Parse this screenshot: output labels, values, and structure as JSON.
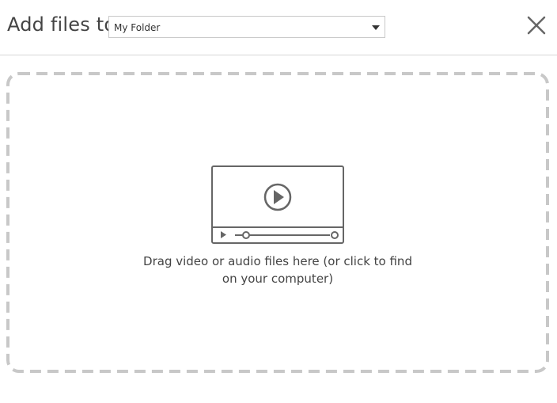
{
  "header": {
    "title": "Add files to",
    "folder_select": {
      "value": "My Folder"
    },
    "close_icon": "close-icon"
  },
  "dropzone": {
    "text_line1": "Drag video or audio files here (or click to find",
    "text_line2": "on your computer)",
    "icon": "video-player-icon"
  },
  "colors": {
    "text": "#444444",
    "border": "#d6d6d6",
    "dashed_border": "#c8c8c8",
    "icon": "#666666"
  }
}
